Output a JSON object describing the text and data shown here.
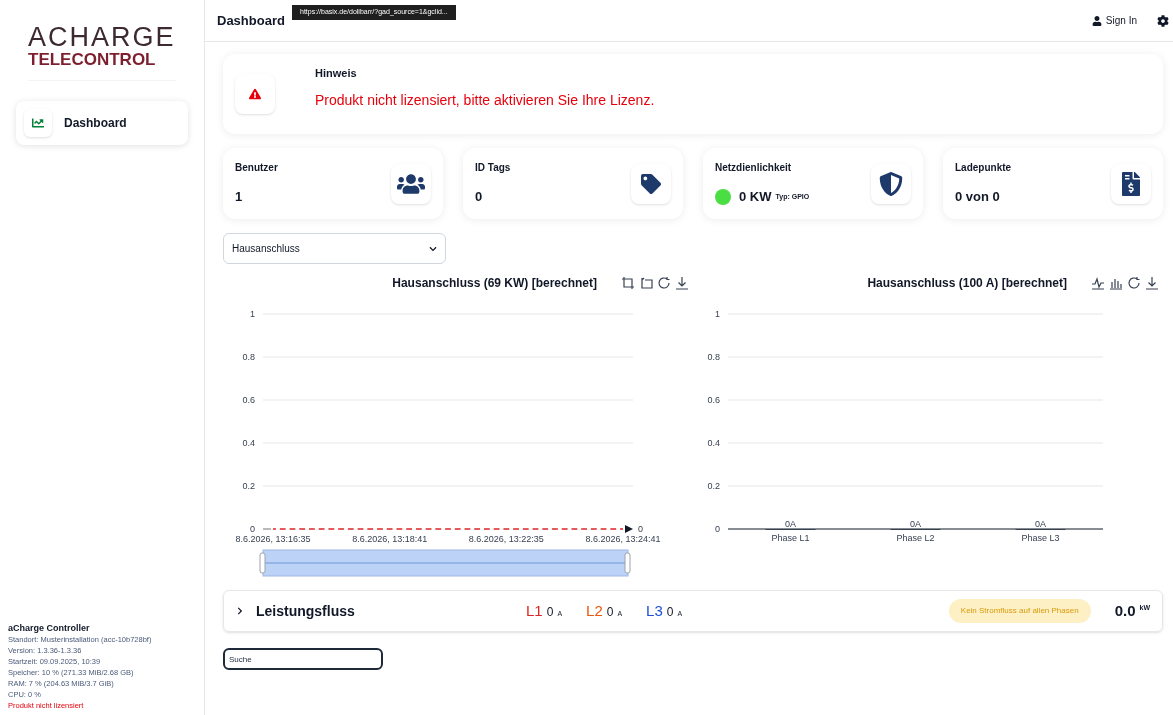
{
  "sidebar": {
    "logo": {
      "top": "ACHARGE",
      "bottom": "TELECONTROL"
    },
    "items": [
      {
        "label": "Dashboard",
        "selected": true
      }
    ],
    "footer": {
      "title": "aCharge Controller",
      "lines": [
        {
          "text": "Standort: Musterinstallation (acc-10b728bf)",
          "kind": "info"
        },
        {
          "text": "Version: 1.3.36-1.3.36",
          "kind": "info"
        },
        {
          "text": "Startzeit: 09.09.2025, 10:39",
          "kind": "info"
        },
        {
          "text": "Speicher: 10 % (271.33 MiB/2.68 GB)",
          "kind": "info"
        },
        {
          "text": "RAM: 7 % (204.63 MiB/3.7 GiB)",
          "kind": "info"
        },
        {
          "text": "CPU: 0 %",
          "kind": "info"
        },
        {
          "text": "Produkt nicht lizensiert",
          "kind": "error"
        }
      ]
    }
  },
  "header": {
    "title": "Dashboard",
    "tooltip": "https://basix.de/dolibarr/?gad_source=1&gclid...",
    "sign_in": "Sign In"
  },
  "notice": {
    "title": "Hinweis",
    "message": "Produkt nicht lizensiert, bitte aktivieren Sie Ihre Lizenz."
  },
  "stats": [
    {
      "label": "Benutzer",
      "value": "1",
      "kind": "users"
    },
    {
      "label": "ID Tags",
      "value": "0",
      "kind": "tag"
    },
    {
      "label": "Netzdienlichkeit",
      "value": "0 KW",
      "sub": "Typ: GPIO",
      "kind": "shield",
      "color": "#4ade43"
    },
    {
      "label": "Ladepunkte",
      "value": "0 von 0",
      "kind": "invoice"
    }
  ],
  "select": {
    "value": "Hausanschluss"
  },
  "charts": [
    {
      "title": "Hausanschluss (69 KW) [berechnet]",
      "tools": [
        {
          "kind": "crop"
        },
        {
          "kind": "crop-back"
        },
        {
          "kind": "refresh"
        },
        {
          "kind": "download"
        }
      ],
      "chart_data": {
        "type": "line",
        "categories": [
          "8.6.2026, 13:16:35",
          "8.6.2026, 13:18:41",
          "8.6.2026, 13:22:35",
          "8.6.2026, 13:24:41"
        ],
        "ylim": [
          0,
          1
        ],
        "yticks": [
          0,
          0.2,
          0.4,
          0.6,
          0.8,
          1
        ],
        "grid": true,
        "series": [
          {
            "color": "#dc2626",
            "line_style": "dashed",
            "values": [
              0,
              0,
              0,
              0
            ]
          }
        ],
        "annotations": [
          "0"
        ]
      }
    },
    {
      "title": "Hausanschluss (100 A) [berechnet]",
      "tools": [
        {
          "kind": "line"
        },
        {
          "kind": "bar"
        },
        {
          "kind": "refresh"
        },
        {
          "kind": "download"
        }
      ],
      "chart_data": {
        "type": "bar",
        "categories": [
          "Phase L1",
          "Phase L2",
          "Phase L3"
        ],
        "ylim": [
          0,
          1
        ],
        "yticks": [
          0,
          0.2,
          0.4,
          0.6,
          0.8,
          1
        ],
        "grid": true,
        "series": [
          {
            "color": "#374151",
            "values": [
              0,
              0,
              0
            ]
          }
        ],
        "value_labels": [
          "0A",
          "0A",
          "0A"
        ]
      }
    }
  ],
  "power_flow": {
    "title": "Leistungsfluss",
    "expanded": false,
    "phases": [
      {
        "label": "L1",
        "value": "0",
        "unit": "A",
        "color": "#dc2626"
      },
      {
        "label": "L2",
        "value": "0",
        "unit": "A",
        "color": "#ea580c"
      },
      {
        "label": "L3",
        "value": "0",
        "unit": "A",
        "color": "#1d4ed8"
      }
    ],
    "status": "Kein Stromfluss auf allen Phasen",
    "total": "0.0",
    "total_unit": "kW"
  },
  "search": {
    "placeholder": "Suche"
  }
}
